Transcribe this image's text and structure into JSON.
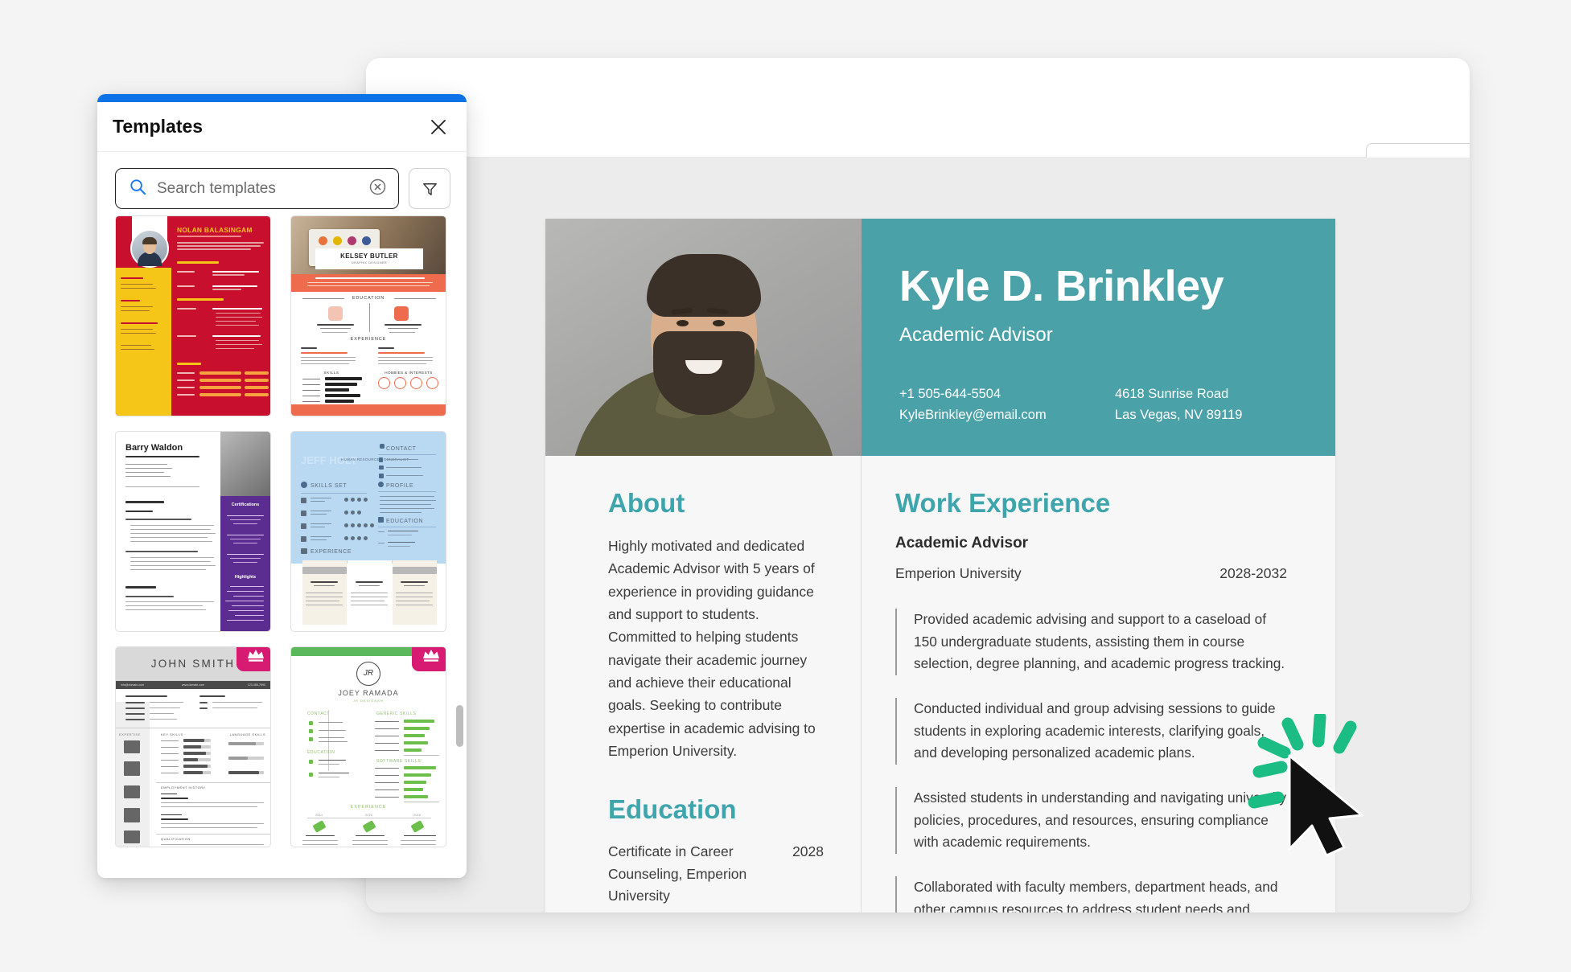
{
  "colors": {
    "panel_accent": "#0b72e7",
    "resume_teal": "#4aa2a8",
    "heading_teal": "#3fa5ad",
    "btn_green": "#008264",
    "btn_blue": "#0d7ae5",
    "crown_pink": "#d81b72",
    "cursor_burst_green": "#1bbd84"
  },
  "toolbar": {
    "outline_button_label": "",
    "green_button_label": "",
    "blue_button_label": ""
  },
  "templates_panel": {
    "title": "Templates",
    "close_icon": "close-icon",
    "search": {
      "placeholder": "Search templates",
      "value": "",
      "search_icon": "search-icon",
      "clear_icon": "clear-circle-icon"
    },
    "filter_icon": "filter-funnel-icon",
    "items": [
      {
        "name": "NOLAN BALASINGAM",
        "style": "red-yellow",
        "premium": false
      },
      {
        "name": "KELSEY BUTLER",
        "subtitle": "GRAPHIC DESIGNER",
        "style": "orange-photo",
        "premium": false
      },
      {
        "name": "Barry Waldon",
        "subtitle": "Registered Nurse and Master of Health Admin",
        "style": "purple",
        "premium": false
      },
      {
        "name": "JEFF HOLT",
        "subtitle": "HUMAN RESOURCES GENERALIST",
        "style": "light-blue",
        "premium": false
      },
      {
        "name": "JOHN SMITH",
        "style": "grayscale",
        "premium": true
      },
      {
        "name": "JOEY RAMADA",
        "subtitle": "JR DESIGNER",
        "style": "green",
        "premium": true
      }
    ]
  },
  "resume": {
    "name": "Kyle D. Brinkley",
    "role": "Academic Advisor",
    "contact": {
      "phone": "+1 505-644-5504",
      "email": "KyleBrinkley@email.com",
      "address_line1": "4618 Sunrise Road",
      "address_line2": "Las Vegas, NV 89119"
    },
    "about": {
      "heading": "About",
      "text": "Highly motivated and dedicated Academic Advisor with 5 years of experience in providing guidance and support to students. Committed to helping students navigate their academic journey and achieve their educational goals. Seeking to contribute expertise in academic advising to Emperion University."
    },
    "education": {
      "heading": "Education",
      "degree": "Certificate in Career Counseling, Emperion University",
      "year": "2028"
    },
    "work_experience": {
      "heading": "Work Experience",
      "job_title": "Academic Advisor",
      "employer": "Emperion University",
      "dates": "2028-2032",
      "bullets": [
        "Provided academic advising and support to a caseload of 150 undergraduate students, assisting them in course selection, degree planning, and academic progress tracking.",
        "Conducted individual and group advising sessions to guide students in exploring academic interests, clarifying goals, and developing personalized academic plans.",
        "Assisted students in understanding and navigating university policies, procedures, and resources, ensuring compliance with academic requirements.",
        "Collaborated with faculty members, department heads, and other campus resources to address student needs and resolve academic challenges."
      ]
    }
  },
  "cursor": {
    "icon": "mouse-pointer-click-icon"
  }
}
